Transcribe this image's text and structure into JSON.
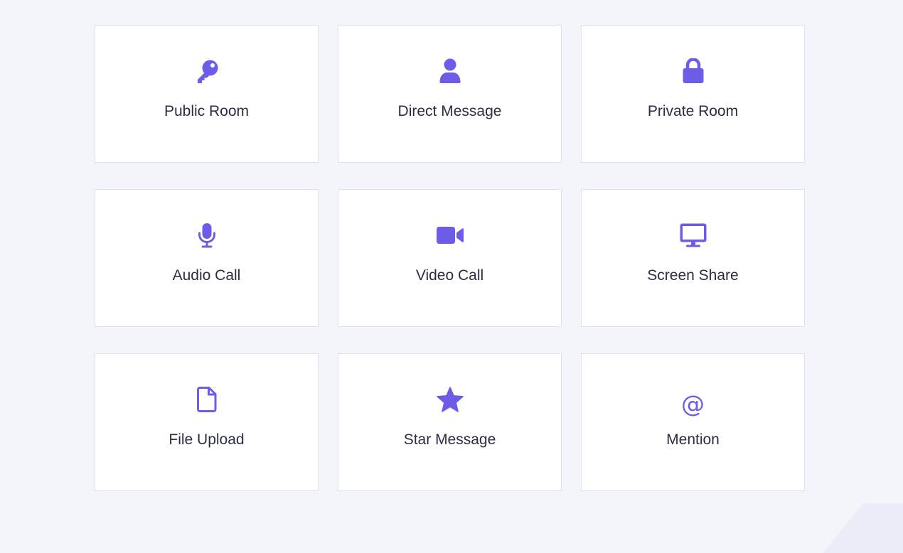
{
  "colors": {
    "accent": "#6c5ce7",
    "text": "#2b2d42",
    "background": "#f4f5fb",
    "card": "#ffffff",
    "card_border": "#e0e0ef"
  },
  "features": [
    {
      "label": "Public Room",
      "icon": "key-icon"
    },
    {
      "label": "Direct Message",
      "icon": "user-icon"
    },
    {
      "label": "Private Room",
      "icon": "lock-icon"
    },
    {
      "label": "Audio Call",
      "icon": "microphone-icon"
    },
    {
      "label": "Video Call",
      "icon": "video-camera-icon"
    },
    {
      "label": "Screen Share",
      "icon": "monitor-icon"
    },
    {
      "label": "File Upload",
      "icon": "file-icon"
    },
    {
      "label": "Star Message",
      "icon": "star-icon"
    },
    {
      "label": "Mention",
      "icon": "at-sign-icon",
      "glyph": "@"
    }
  ]
}
